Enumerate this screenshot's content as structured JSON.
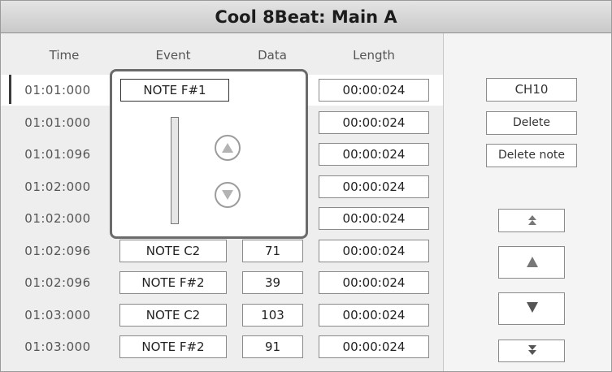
{
  "title": "Cool 8Beat: Main A",
  "columns": {
    "time": "Time",
    "event": "Event",
    "data": "Data",
    "length": "Length"
  },
  "rows": [
    {
      "time": "01:01:000",
      "event": "",
      "data": "",
      "length": "00:00:024"
    },
    {
      "time": "01:01:000",
      "event": "",
      "data": "",
      "length": "00:00:024"
    },
    {
      "time": "01:01:096",
      "event": "",
      "data": "",
      "length": "00:00:024"
    },
    {
      "time": "01:02:000",
      "event": "",
      "data": "",
      "length": "00:00:024"
    },
    {
      "time": "01:02:000",
      "event": "",
      "data": "",
      "length": "00:00:024"
    },
    {
      "time": "01:02:096",
      "event": "NOTE C2",
      "data": "71",
      "length": "00:00:024"
    },
    {
      "time": "01:02:096",
      "event": "NOTE F#2",
      "data": "39",
      "length": "00:00:024"
    },
    {
      "time": "01:03:000",
      "event": "NOTE C2",
      "data": "103",
      "length": "00:00:024"
    },
    {
      "time": "01:03:000",
      "event": "NOTE F#2",
      "data": "91",
      "length": "00:00:024"
    }
  ],
  "selected_row_index": 0,
  "popup": {
    "event_value": "NOTE F#1",
    "slider_level": 0.0,
    "up_icon": "triangle-up-circle-icon",
    "down_icon": "triangle-down-circle-icon"
  },
  "side": {
    "channel": "CH10",
    "delete": "Delete",
    "delete_note": "Delete note",
    "nav_icons": [
      "double-up-icon",
      "up-icon",
      "down-icon",
      "double-down-icon"
    ]
  }
}
